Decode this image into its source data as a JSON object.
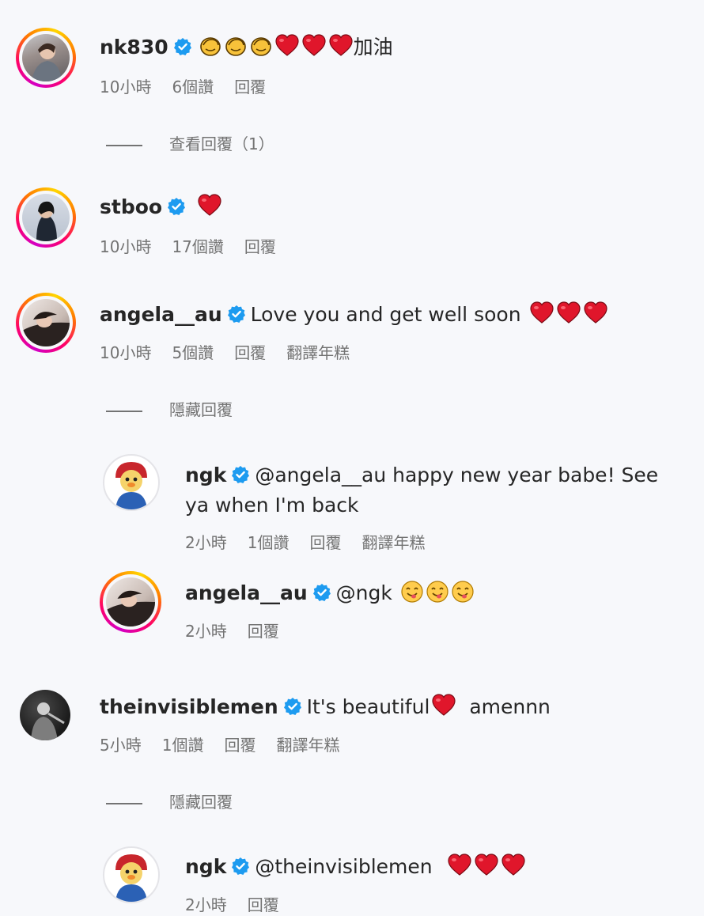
{
  "comments": [
    {
      "username": "nk830",
      "text_suffix": "加油",
      "time": "10小時",
      "likes": "6個讚",
      "reply": "回覆"
    },
    {
      "username": "stboo",
      "time": "10小時",
      "likes": "17個讚",
      "reply": "回覆"
    },
    {
      "username": "angela__au",
      "text": "Love you and get well soon",
      "time": "10小時",
      "likes": "5個讚",
      "reply": "回覆",
      "translate": "翻譯年糕"
    },
    {
      "username": "ngk",
      "mention": "@angela__au",
      "text": "happy new year babe! See ya when I'm back",
      "time": "2小時",
      "likes": "1個讚",
      "reply": "回覆",
      "translate": "翻譯年糕"
    },
    {
      "username": "angela__au",
      "mention": "@ngk",
      "time": "2小時",
      "reply": "回覆"
    },
    {
      "username": "theinvisiblemen",
      "text": "It's beautiful",
      "text_after": "amennn",
      "time": "5小時",
      "likes": "1個讚",
      "reply": "回覆",
      "translate": "翻譯年糕"
    },
    {
      "username": "ngk",
      "mention": "@theinvisiblemen",
      "time": "2小時",
      "reply": "回覆"
    }
  ],
  "threads": {
    "view_replies": "查看回覆（1）",
    "hide_replies_1": "隱藏回覆",
    "hide_replies_2": "隱藏回覆"
  },
  "colors": {
    "verified": "#1d9bf0",
    "heart": "#e0162b",
    "meta": "#737373"
  },
  "icons": [
    "verified-badge-icon",
    "clap-emoji-icon",
    "red-heart-emoji-icon",
    "smiling-face-emoji-icon"
  ]
}
